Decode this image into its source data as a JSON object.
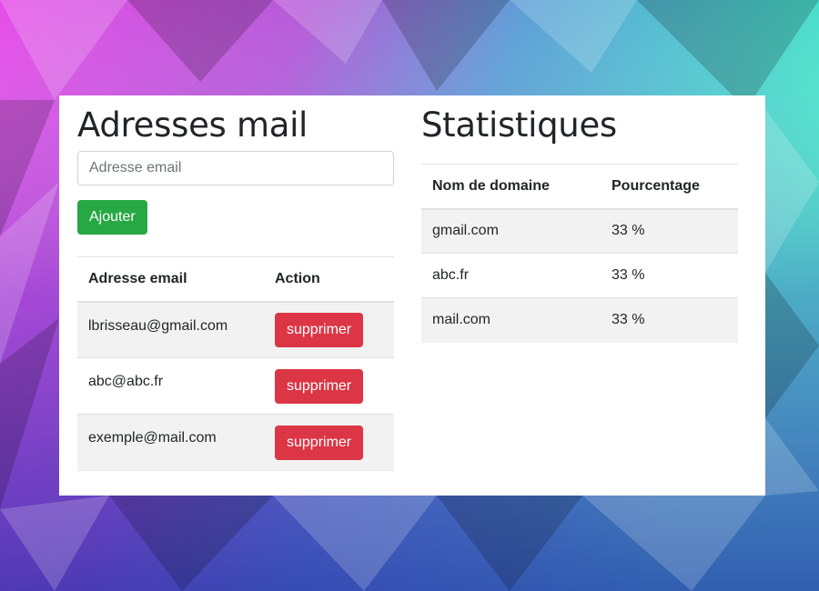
{
  "colors": {
    "success": "#28a745",
    "danger": "#dc3545",
    "stripe": "#f2f2f2"
  },
  "emails_section": {
    "title": "Adresses mail",
    "input_placeholder": "Adresse email",
    "add_button": "Ajouter",
    "table": {
      "headers": [
        "Adresse email",
        "Action"
      ],
      "rows": [
        {
          "email": "lbrisseau@gmail.com",
          "action": "supprimer"
        },
        {
          "email": "abc@abc.fr",
          "action": "supprimer"
        },
        {
          "email": "exemple@mail.com",
          "action": "supprimer"
        }
      ]
    }
  },
  "stats_section": {
    "title": "Statistiques",
    "table": {
      "headers": [
        "Nom de domaine",
        "Pourcentage"
      ],
      "rows": [
        {
          "domain": "gmail.com",
          "percent": "33 %"
        },
        {
          "domain": "abc.fr",
          "percent": "33 %"
        },
        {
          "domain": "mail.com",
          "percent": "33 %"
        }
      ]
    }
  }
}
